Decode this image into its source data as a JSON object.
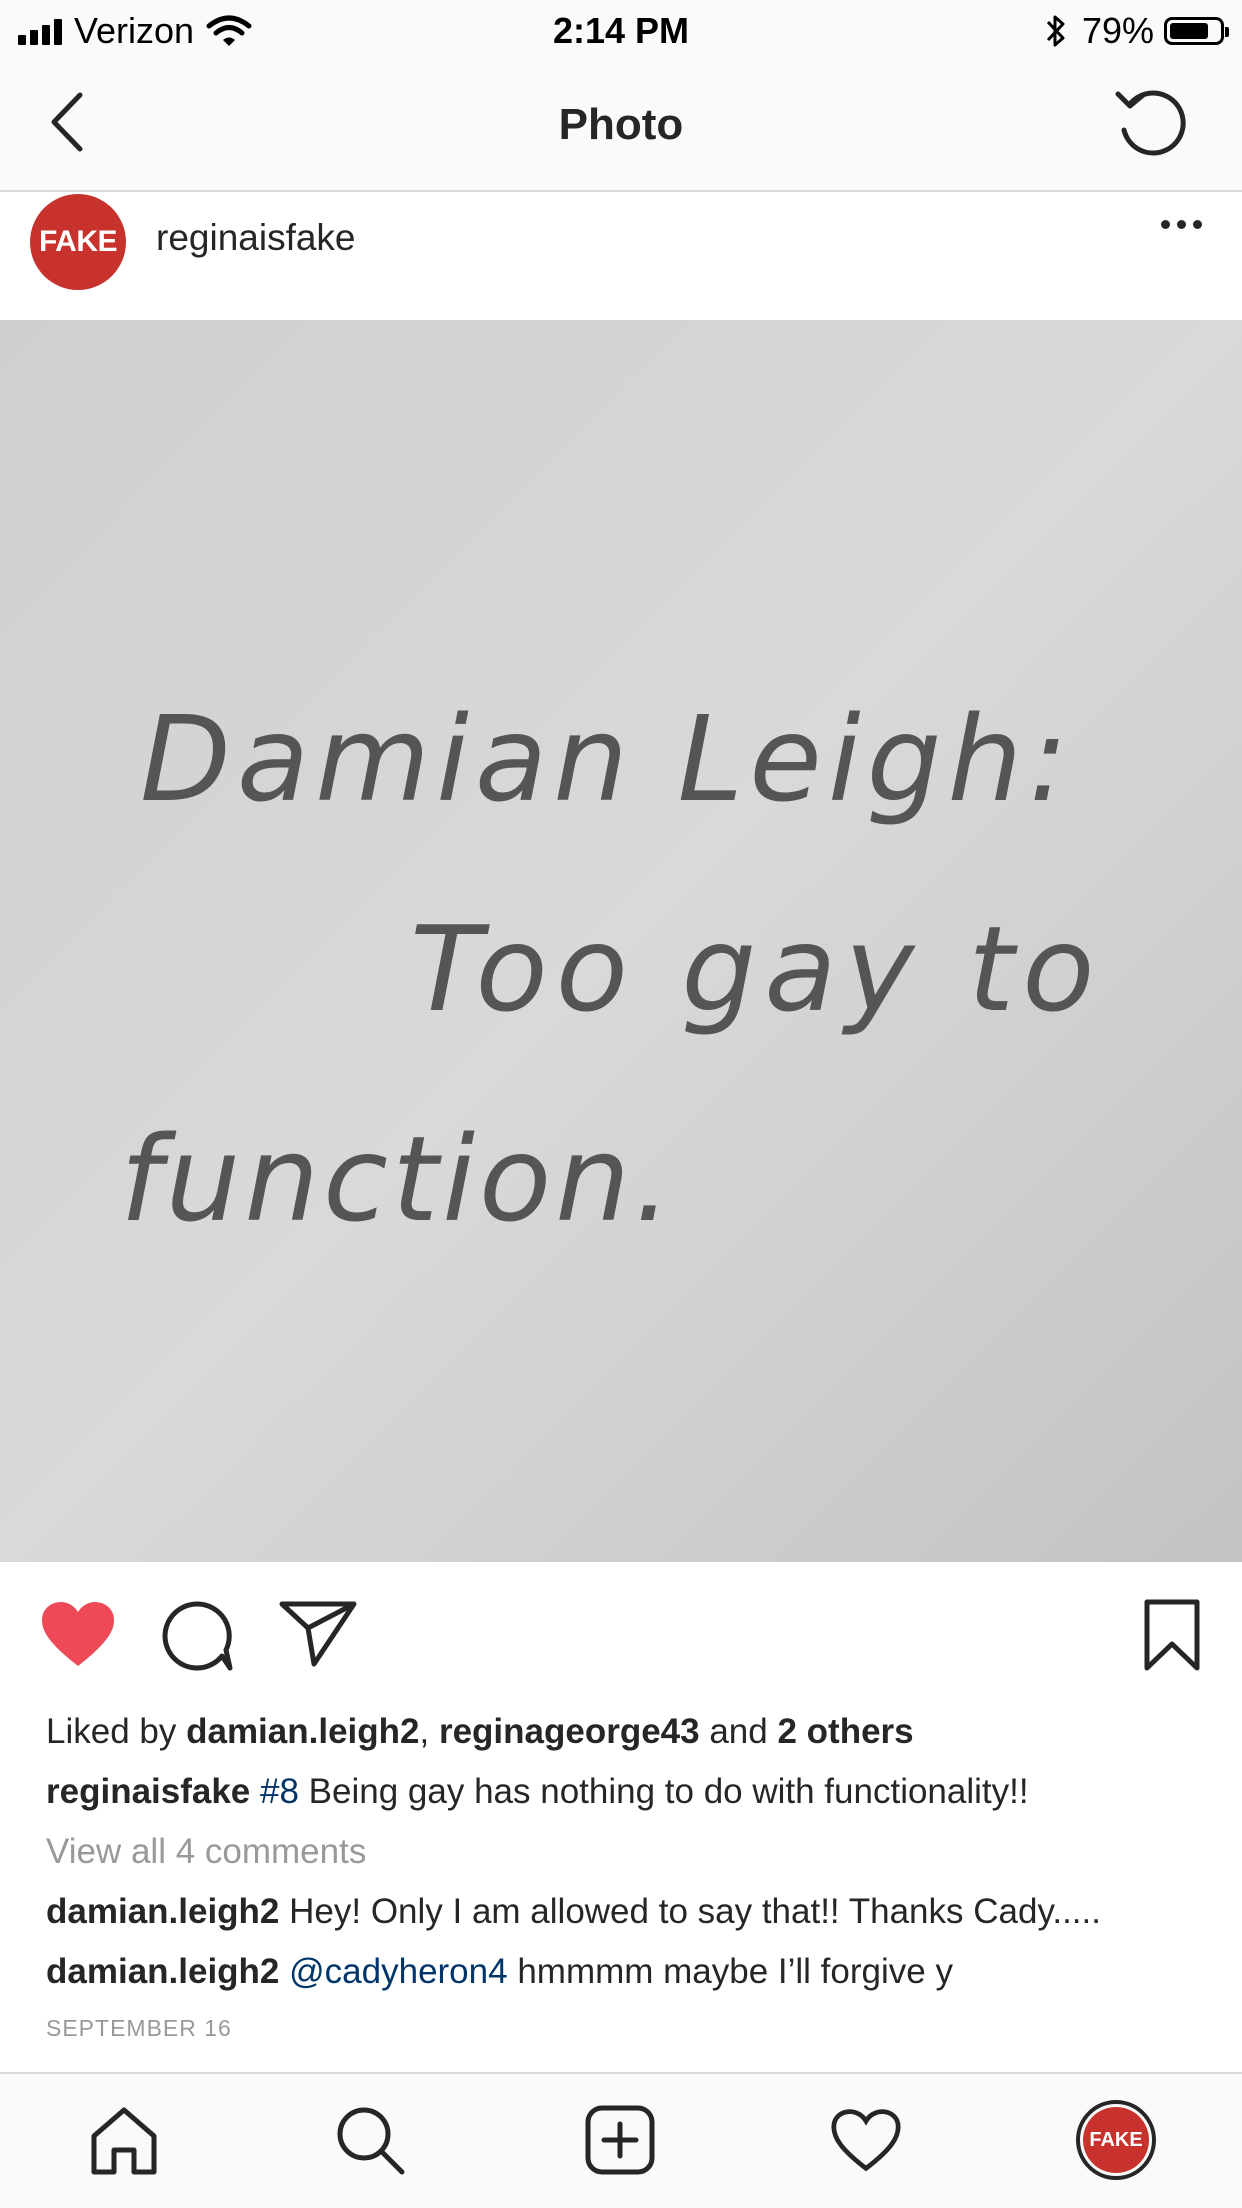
{
  "status_bar": {
    "carrier": "Verizon",
    "time": "2:14 PM",
    "battery_text": "79%",
    "battery_level": 0.79
  },
  "nav": {
    "title": "Photo"
  },
  "post": {
    "avatar_label": "FAKE",
    "username": "reginaisfake",
    "photo_text": [
      "Damian Leigh:",
      "Too gay to",
      "function."
    ],
    "likes": {
      "prefix": "Liked by ",
      "user1": "damian.leigh2",
      "sep": ", ",
      "user2": "reginageorge43",
      "and": " and ",
      "others": "2 others"
    },
    "caption": {
      "user": "reginaisfake",
      "hashtag": "#8",
      "text": " Being gay has nothing to do with functionality!!"
    },
    "view_comments": "View all 4 comments",
    "comments": [
      {
        "user": "damian.leigh2",
        "mention": "",
        "text": " Hey! Only I am allowed to say that!! Thanks Cady....."
      },
      {
        "user": "damian.leigh2",
        "mention": "@cadyheron4",
        "text": " hmmmm maybe I’ll forgive y"
      }
    ],
    "date": "SEPTEMBER 16"
  },
  "tab_bar": {
    "profile_label": "FAKE"
  },
  "colors": {
    "like": "#ed4956",
    "brand": "#c7332c",
    "link": "#003569"
  },
  "icons": [
    "back-icon",
    "refresh-icon",
    "more-icon",
    "heart-filled-icon",
    "comment-icon",
    "share-icon",
    "bookmark-icon",
    "home-icon",
    "search-icon",
    "add-icon",
    "heart-outline-icon"
  ]
}
